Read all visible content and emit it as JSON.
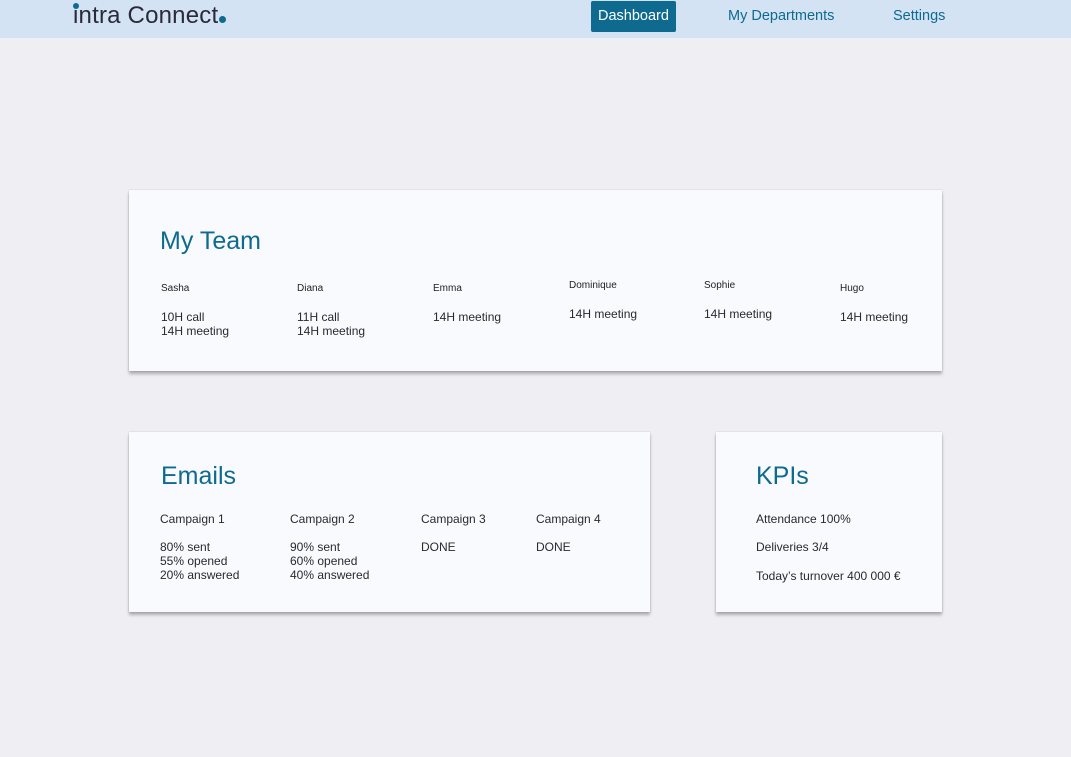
{
  "header": {
    "logo": "intra Connect",
    "nav": [
      {
        "label": "Dashboard",
        "active": true
      },
      {
        "label": "My Departments",
        "active": false
      },
      {
        "label": "Settings",
        "active": false
      }
    ]
  },
  "team": {
    "title": "My Team",
    "members": [
      {
        "name": "Sasha",
        "schedule": [
          "10H call",
          "14H meeting"
        ]
      },
      {
        "name": "Diana",
        "schedule": [
          "11H call",
          "14H meeting"
        ]
      },
      {
        "name": "Emma",
        "schedule": [
          "14H meeting"
        ]
      },
      {
        "name": "Dominique",
        "schedule": [
          "14H meeting"
        ]
      },
      {
        "name": "Sophie",
        "schedule": [
          "14H meeting"
        ]
      },
      {
        "name": "Hugo",
        "schedule": [
          "14H meeting"
        ]
      }
    ]
  },
  "emails": {
    "title": "Emails",
    "campaigns": [
      {
        "name": "Campaign 1",
        "stats": [
          "80% sent",
          "55% opened",
          "20% answered"
        ]
      },
      {
        "name": "Campaign 2",
        "stats": [
          "90% sent",
          "60% opened",
          "40% answered"
        ]
      },
      {
        "name": "Campaign 3",
        "stats": [
          "DONE"
        ]
      },
      {
        "name": "Campaign 4",
        "stats": [
          "DONE"
        ]
      }
    ]
  },
  "kpis": {
    "title": "KPIs",
    "items": [
      "Attendance 100%",
      "Deliveries 3/4",
      "Today’s turnover 400 000 €"
    ]
  },
  "colors": {
    "accent": "#0e6a8f",
    "header_bg": "#d3e3f3",
    "page_bg": "#efeff3",
    "card_bg": "#f8fafd"
  }
}
